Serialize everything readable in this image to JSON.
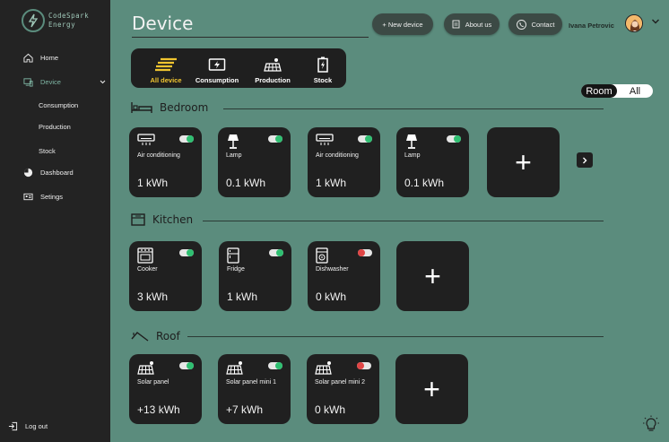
{
  "app": {
    "logo_line1": "CodeSpark",
    "logo_line2": "Energy"
  },
  "sidebar": {
    "home": "Home",
    "device": "Device",
    "consumption": "Consumption",
    "production": "Production",
    "stock": "Stock",
    "dashboard": "Dashboard",
    "settings": "Setings",
    "logout": "Log out"
  },
  "header": {
    "title": "Device",
    "new_device": "+ New device",
    "about": "About us",
    "contact": "Contact",
    "user": "Ivana Petrovic"
  },
  "filters": [
    "All device",
    "Consumption",
    "Production",
    "Stock"
  ],
  "view_toggle": {
    "room": "Room",
    "all": "All"
  },
  "sections": {
    "bedroom": {
      "title": "Bedroom",
      "devices": [
        {
          "name": "Air conditioning",
          "value": "1 kWh",
          "on": true,
          "icon": "air-conditioner-icon"
        },
        {
          "name": "Lamp",
          "value": "0.1 kWh",
          "on": true,
          "icon": "lamp-icon"
        },
        {
          "name": "Air conditioning",
          "value": "1 kWh",
          "on": true,
          "icon": "air-conditioner-icon"
        },
        {
          "name": "Lamp",
          "value": "0.1 kWh",
          "on": true,
          "icon": "lamp-icon"
        }
      ]
    },
    "kitchen": {
      "title": "Kitchen",
      "devices": [
        {
          "name": "Cooker",
          "value": "3 kWh",
          "on": true,
          "icon": "cooker-icon"
        },
        {
          "name": "Fridge",
          "value": "1 kWh",
          "on": true,
          "icon": "fridge-icon"
        },
        {
          "name": "Dishwasher",
          "value": "0 kWh",
          "on": false,
          "icon": "dishwasher-icon"
        }
      ]
    },
    "roof": {
      "title": "Roof",
      "devices": [
        {
          "name": "Solar panel",
          "value": "+13 kWh",
          "on": true,
          "icon": "solar-panel-icon"
        },
        {
          "name": "Solar panel mini 1",
          "value": "+7 kWh",
          "on": true,
          "icon": "solar-panel-icon"
        },
        {
          "name": "Solar panel mini 2",
          "value": "0 kWh",
          "on": false,
          "icon": "solar-panel-icon"
        }
      ]
    }
  },
  "colors": {
    "on": "#2fbf71",
    "off": "#e04545",
    "accent": "#f0c530",
    "bg": "#5b8c7d",
    "sidebar": "#232323"
  }
}
